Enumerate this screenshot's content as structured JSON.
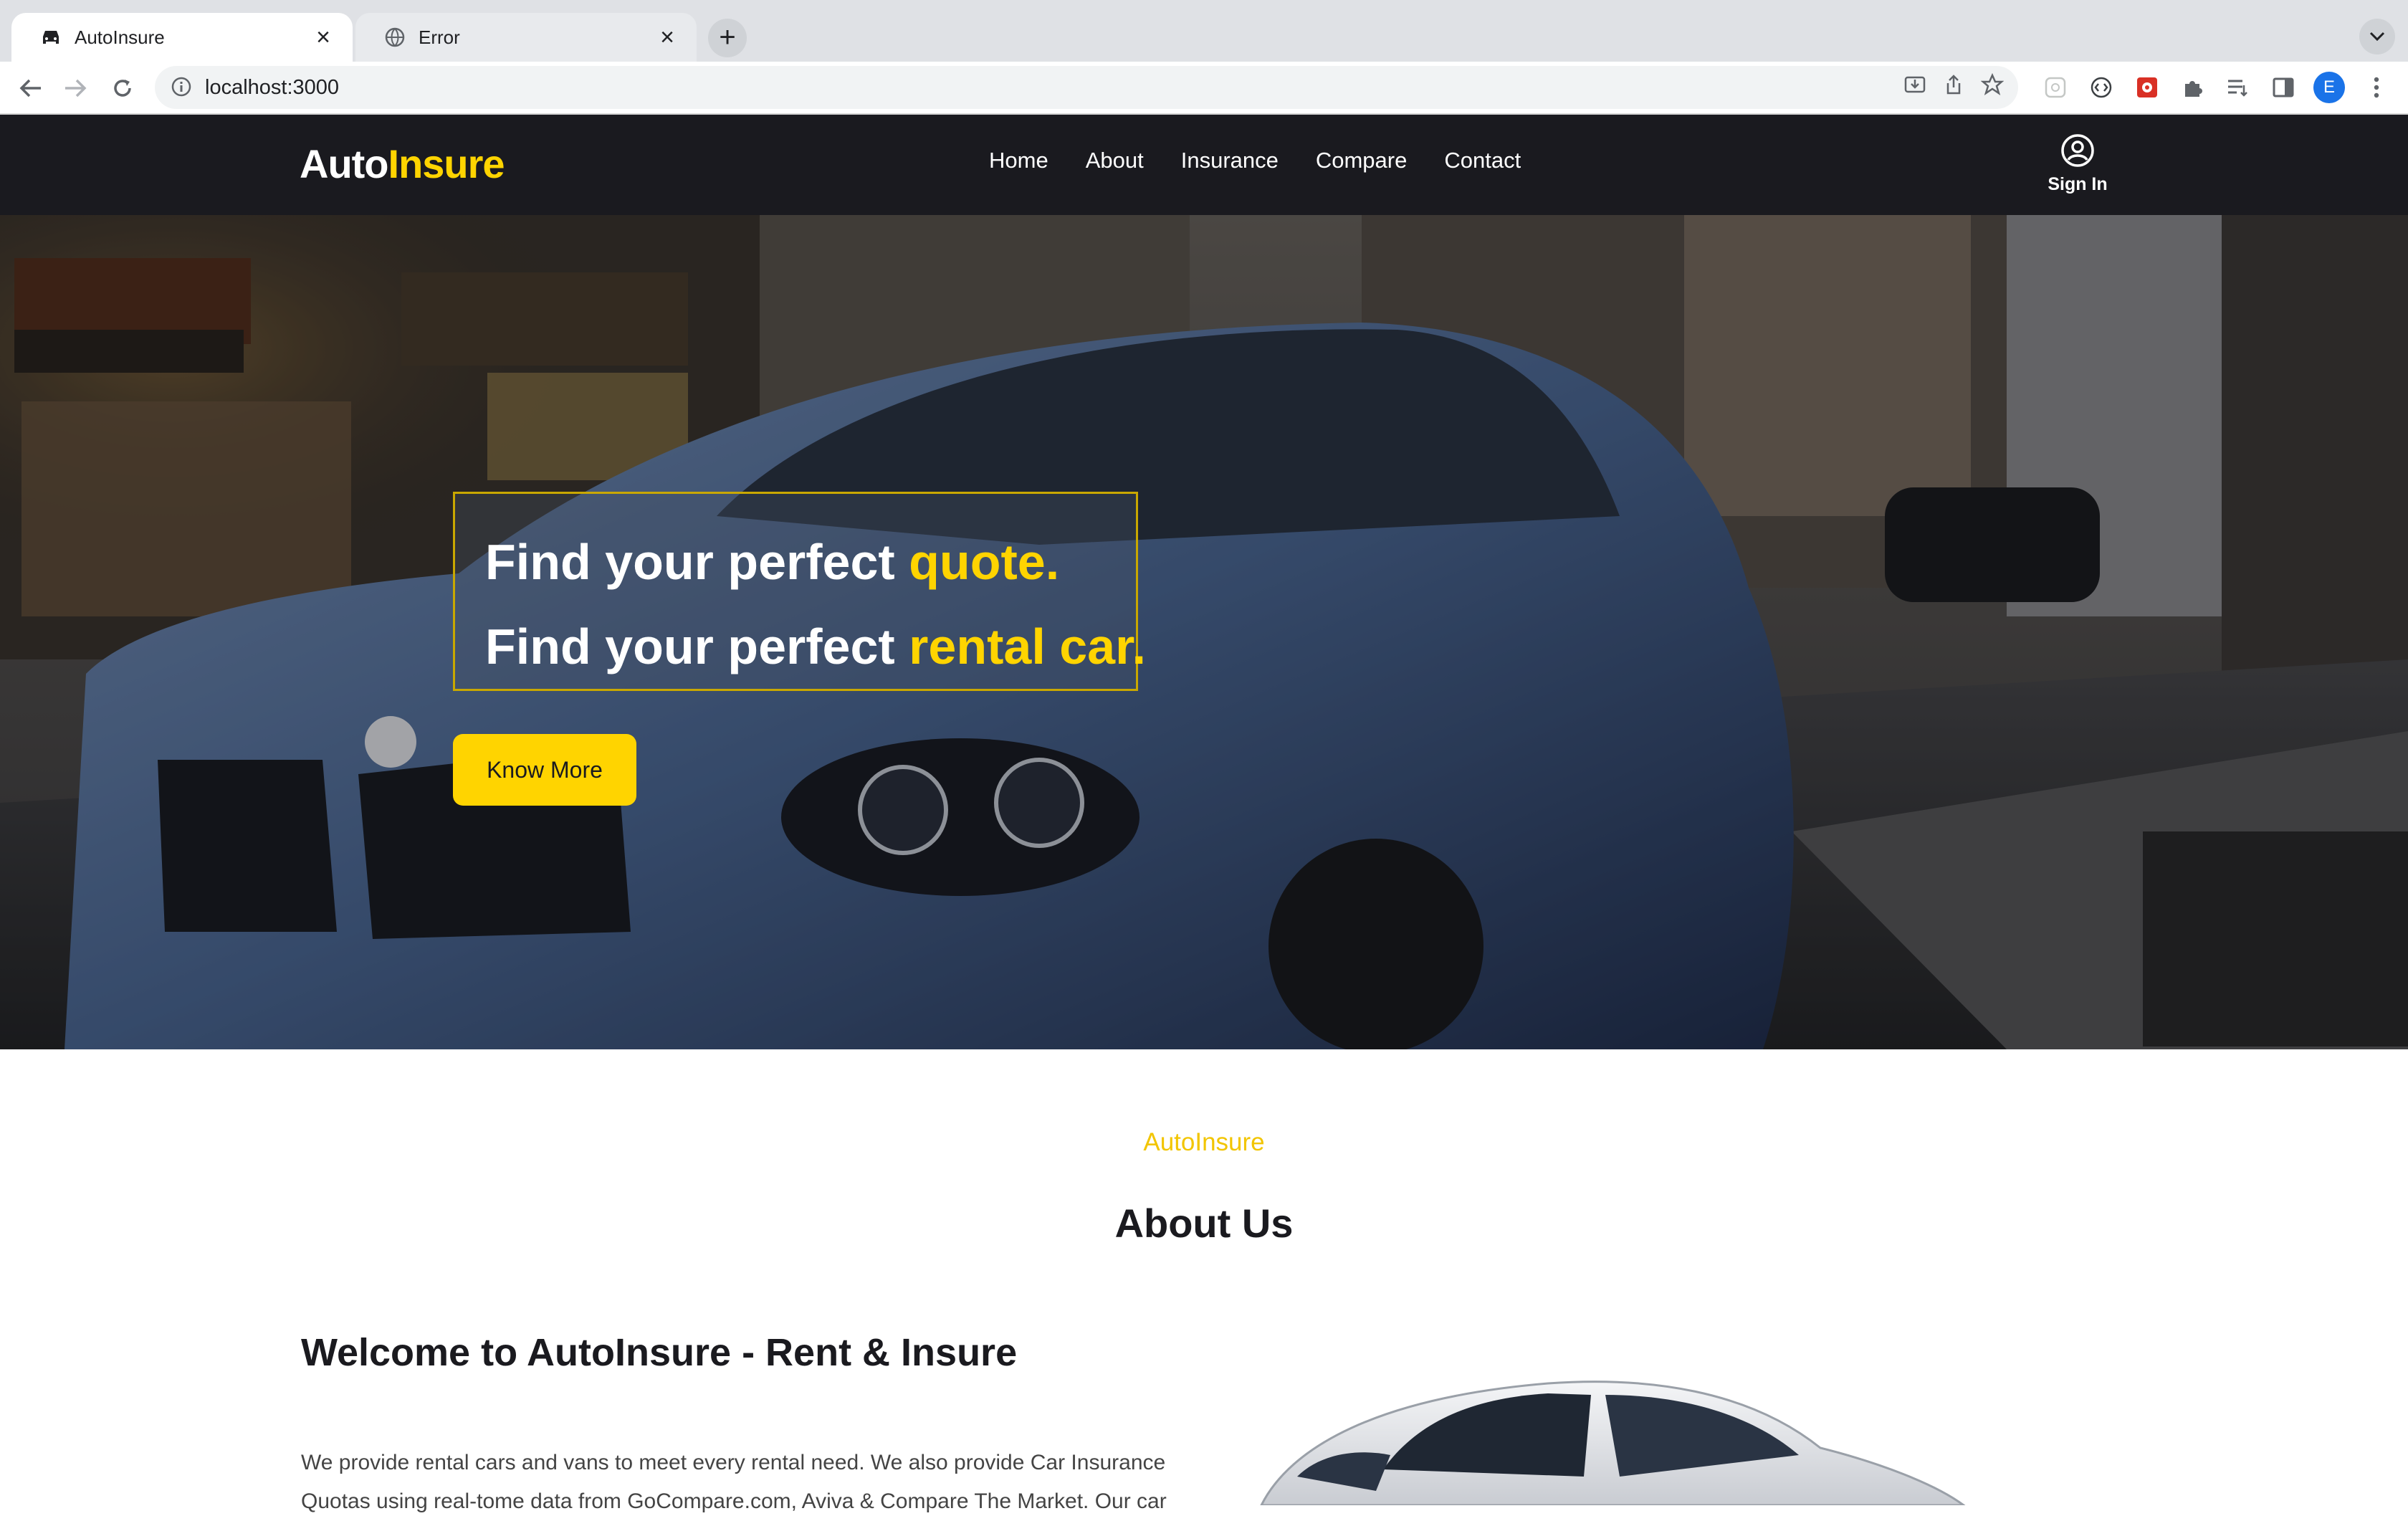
{
  "browser": {
    "tabs": [
      {
        "title": "AutoInsure",
        "icon": "car-icon",
        "active": true
      },
      {
        "title": "Error",
        "icon": "globe-icon",
        "active": false
      }
    ],
    "url": "localhost:3000",
    "profile_initial": "E"
  },
  "header": {
    "logo_part1": "Auto",
    "logo_part2": "Insure",
    "nav": [
      "Home",
      "About",
      "Insurance",
      "Compare",
      "Contact"
    ],
    "signin_label": "Sign In"
  },
  "hero": {
    "line1_white": "Find your perfect ",
    "line1_accent": "quote.",
    "line2_white": "Find your perfect ",
    "line2_accent": "rental car.",
    "cta_label": "Know More"
  },
  "about": {
    "kicker": "AutoInsure",
    "title": "About Us",
    "welcome": "Welcome to AutoInsure - Rent & Insure",
    "text": "We provide rental cars and vans to meet every rental need. We also provide Car Insurance Quotas using real-tome data from GoCompare.com, Aviva & Compare The Market. Our car"
  },
  "colors": {
    "accent": "#ffd400",
    "header_bg": "#1a1a1f"
  }
}
